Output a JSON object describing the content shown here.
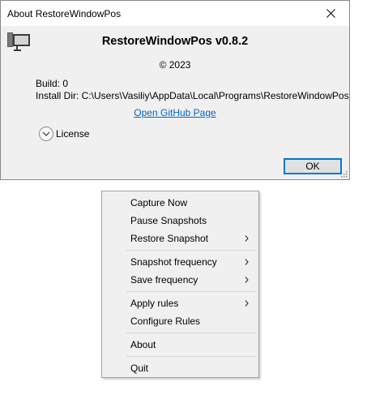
{
  "about_dialog": {
    "title": "About RestoreWindowPos",
    "app_name": "RestoreWindowPos v0.8.2",
    "copyright": "© 2023",
    "build_line": "Build: 0",
    "install_dir_line": "Install Dir: C:\\Users\\Vasiliy\\AppData\\Local\\Programs\\RestoreWindowPos",
    "github_link": "Open GitHub Page",
    "license_toggle": "License",
    "ok_label": "OK",
    "icons": {
      "app": "monitor-icon",
      "close": "close-icon",
      "expander": "chevron-down-icon",
      "grip": "resize-grip-icon"
    }
  },
  "tray_menu": {
    "items": [
      {
        "label": "Capture Now",
        "submenu": false
      },
      {
        "label": "Pause Snapshots",
        "submenu": false
      },
      {
        "label": "Restore Snapshot",
        "submenu": true
      },
      {
        "label": "Snapshot frequency",
        "submenu": true
      },
      {
        "label": "Save frequency",
        "submenu": true
      },
      {
        "label": "Apply rules",
        "submenu": true
      },
      {
        "label": "Configure Rules",
        "submenu": false
      },
      {
        "label": "About",
        "submenu": false
      },
      {
        "label": "Quit",
        "submenu": false
      }
    ]
  },
  "colors": {
    "dialog_bg": "#f0f0f0",
    "link": "#0066cc",
    "focus_border": "#0078d7"
  }
}
